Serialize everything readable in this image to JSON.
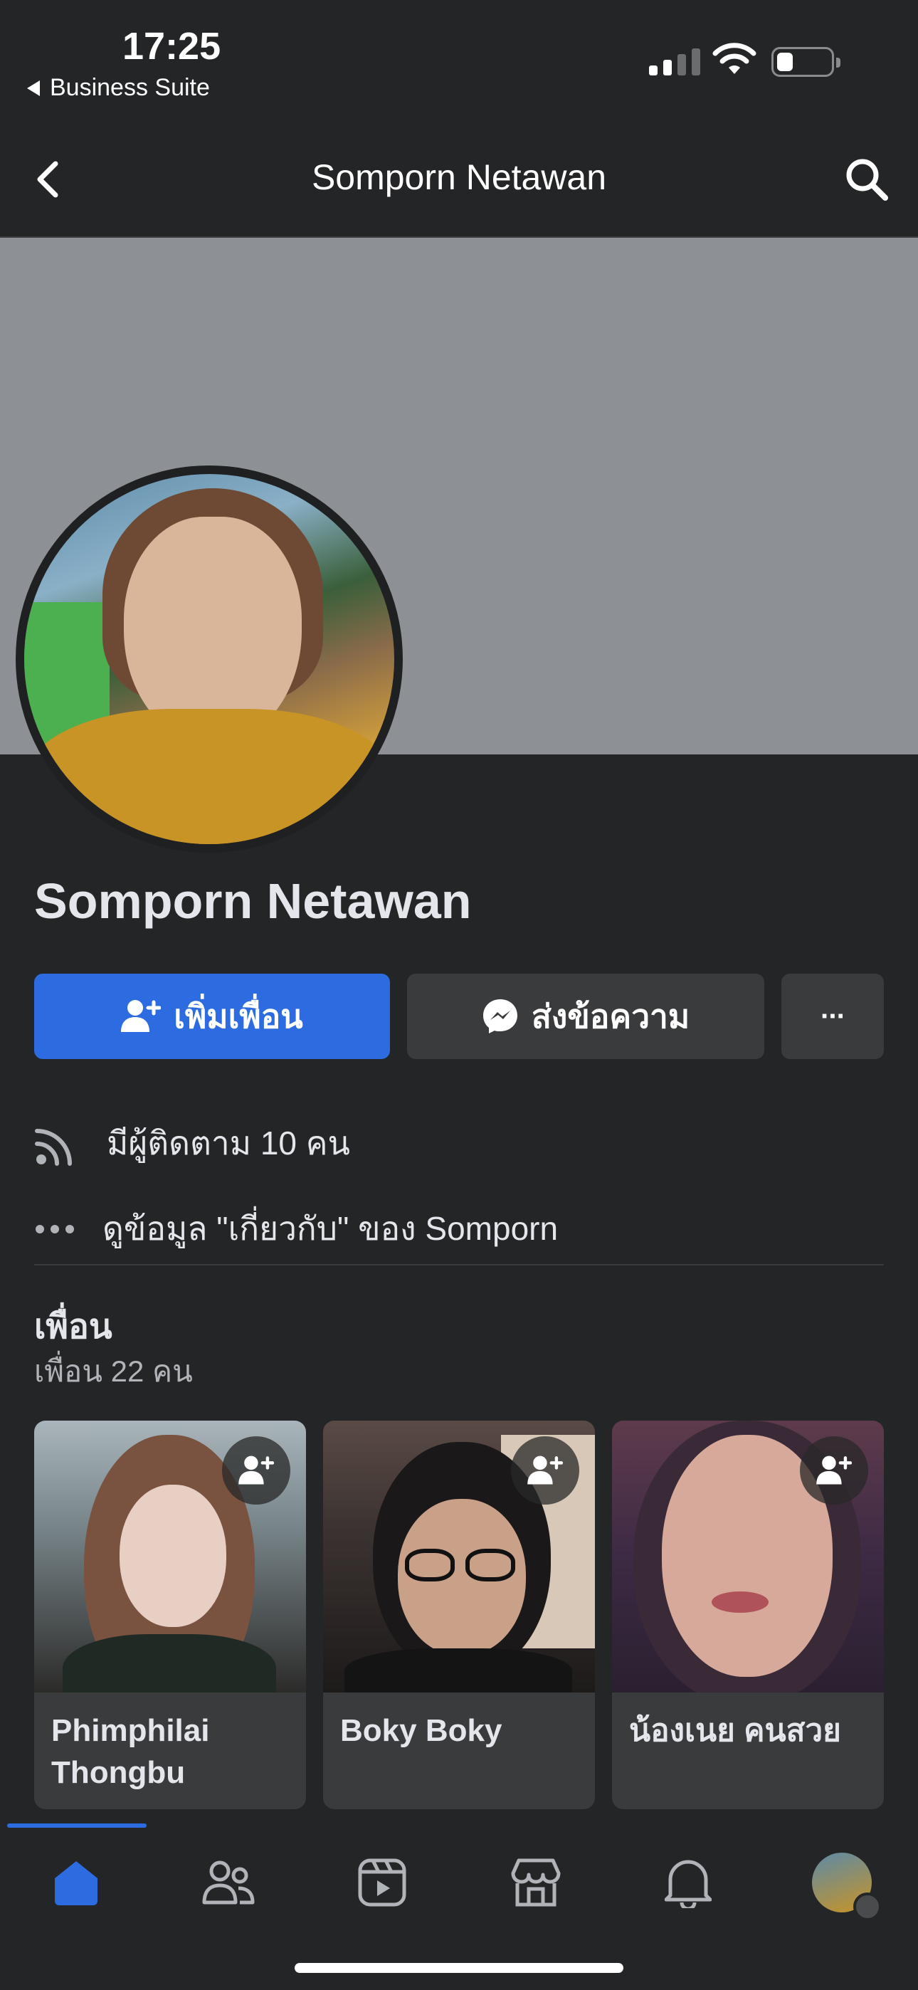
{
  "status_bar": {
    "time": "17:25",
    "back_app": "Business Suite",
    "battery_level": 0.3
  },
  "nav": {
    "title": "Somporn Netawan",
    "back_icon": "chevron-left-icon",
    "search_icon": "search-icon"
  },
  "profile": {
    "name": "Somporn Netawan"
  },
  "actions": {
    "add_friend_label": "เพิ่มเพื่อน",
    "message_label": "ส่งข้อความ",
    "more_label": "···"
  },
  "info": {
    "followers": "มีผู้ติดตาม 10 คน",
    "about": "ดูข้อมูล \"เกี่ยวกับ\" ของ Somporn"
  },
  "friends": {
    "title": "เพื่อน",
    "count": "เพื่อน 22 คน",
    "items": [
      {
        "name": "Phimphilai Thongbu"
      },
      {
        "name": "Boky Boky"
      },
      {
        "name": "น้องเนย คนสวย"
      }
    ]
  },
  "colors": {
    "background": "#242526",
    "accent": "#2d6ce0",
    "button_secondary": "#3a3b3c",
    "cover": "#8d9195"
  },
  "tab_bar": {
    "tabs": [
      "home-icon",
      "friends-icon",
      "video-icon",
      "marketplace-icon",
      "notifications-icon",
      "profile-menu-icon"
    ],
    "active": "home-icon"
  }
}
